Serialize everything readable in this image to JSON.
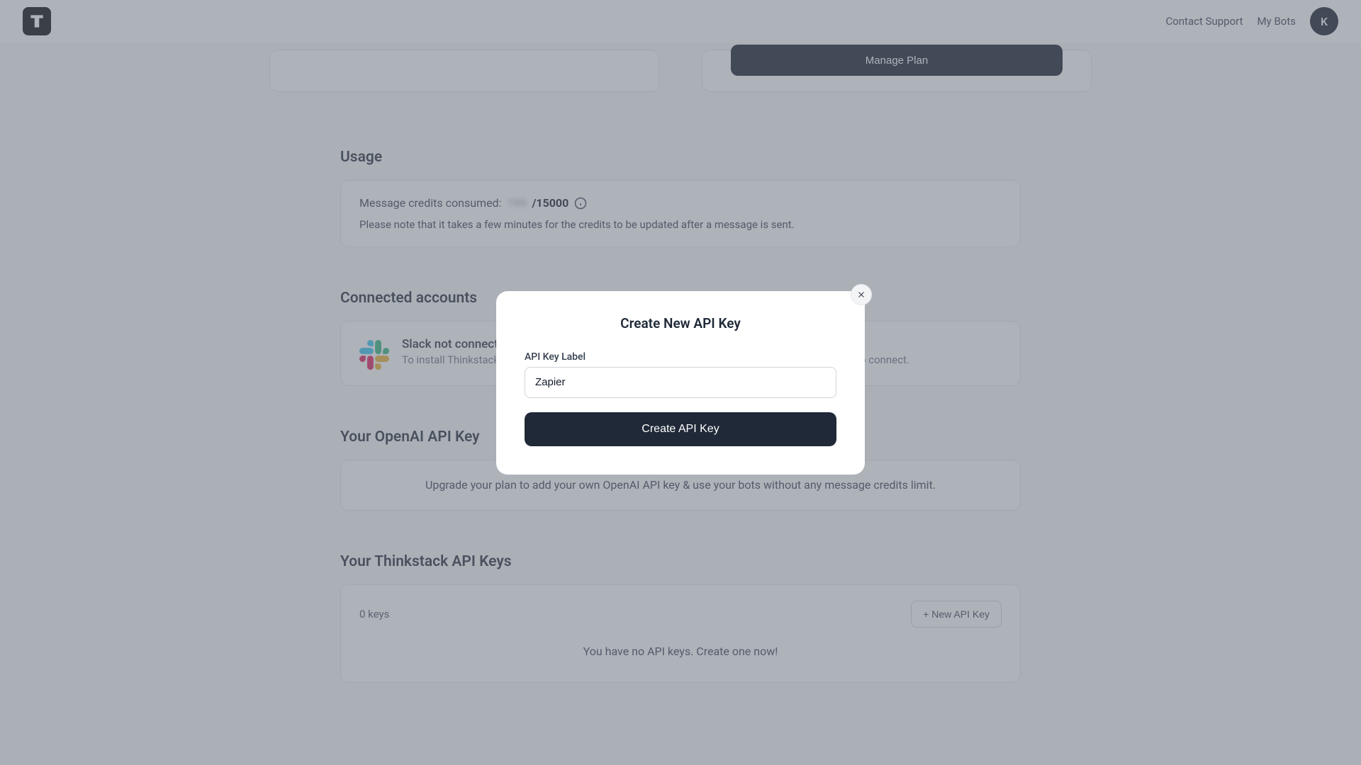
{
  "header": {
    "contact_support": "Contact Support",
    "my_bots": "My Bots",
    "avatar_initial": "K"
  },
  "top": {
    "manage_plan": "Manage Plan"
  },
  "usage": {
    "title": "Usage",
    "label": "Message credits consumed:",
    "consumed_blur": "199",
    "total_prefix": "/15000",
    "note": "Please note that it takes a few minutes for the credits to be updated after a message is sent."
  },
  "connected": {
    "title": "Connected accounts",
    "slack_title": "Slack not connected",
    "slack_desc": "To install Thinkstack on your slack workspace, navigate to the share tab of the chatbot you want to connect."
  },
  "openai": {
    "title": "Your OpenAI API Key",
    "desc": "Upgrade your plan to add your own OpenAI API key & use your bots without any message credits limit."
  },
  "thinkstack_keys": {
    "title": "Your Thinkstack API Keys",
    "count_label": "0 keys",
    "new_key_btn": "+ New API Key",
    "empty_text": "You have no API keys. Create one now!"
  },
  "modal": {
    "title": "Create New API Key",
    "label": "API Key Label",
    "input_value": "Zapier",
    "submit": "Create API Key"
  }
}
